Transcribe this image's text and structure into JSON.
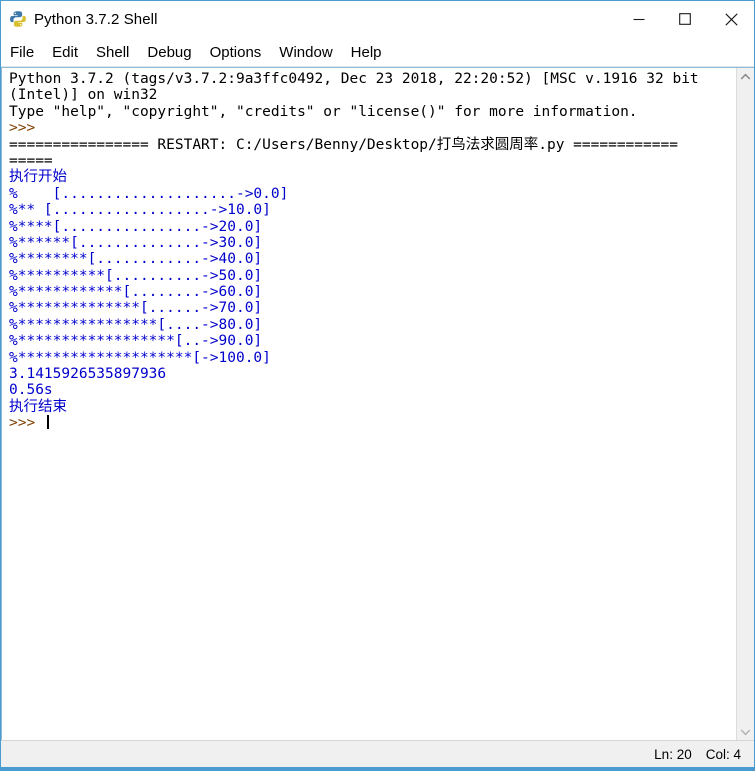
{
  "window": {
    "title": "Python 3.7.2 Shell",
    "icon": "python-logo-icon",
    "controls": {
      "minimize": "minimize-icon",
      "maximize": "maximize-icon",
      "close": "close-icon"
    }
  },
  "menubar": {
    "items": [
      {
        "label": "File"
      },
      {
        "label": "Edit"
      },
      {
        "label": "Shell"
      },
      {
        "label": "Debug"
      },
      {
        "label": "Options"
      },
      {
        "label": "Window"
      },
      {
        "label": "Help"
      }
    ]
  },
  "console": {
    "lines": [
      {
        "text": "Python 3.7.2 (tags/v3.7.2:9a3ffc0492, Dec 23 2018, 22:20:52) [MSC v.1916 32 bit",
        "color": "black"
      },
      {
        "text": "(Intel)] on win32",
        "color": "black"
      },
      {
        "text": "Type \"help\", \"copyright\", \"credits\" or \"license()\" for more information.",
        "color": "black"
      },
      {
        "text": ">>> ",
        "color": "prompt"
      },
      {
        "text": "================ RESTART: C:/Users/Benny/Desktop/打鸟法求圆周率.py ============",
        "color": "black"
      },
      {
        "text": "=====",
        "color": "black"
      },
      {
        "text": "执行开始",
        "color": "blue"
      },
      {
        "text": "%    [....................->0.0]",
        "color": "blue"
      },
      {
        "text": "%** [..................->10.0]",
        "color": "blue"
      },
      {
        "text": "%****[................->20.0]",
        "color": "blue"
      },
      {
        "text": "%******[..............->30.0]",
        "color": "blue"
      },
      {
        "text": "%********[............->40.0]",
        "color": "blue"
      },
      {
        "text": "%**********[..........->50.0]",
        "color": "blue"
      },
      {
        "text": "%************[........->60.0]",
        "color": "blue"
      },
      {
        "text": "%**************[......->70.0]",
        "color": "blue"
      },
      {
        "text": "%****************[....->80.0]",
        "color": "blue"
      },
      {
        "text": "%******************[..->90.0]",
        "color": "blue"
      },
      {
        "text": "%********************[->100.0]",
        "color": "blue"
      },
      {
        "text": "3.1415926535897936",
        "color": "blue"
      },
      {
        "text": "0.56s",
        "color": "blue"
      },
      {
        "text": "执行结束",
        "color": "blue"
      },
      {
        "text": ">>> ",
        "color": "prompt",
        "caret": true
      }
    ]
  },
  "scrollbar": {
    "up_arrow": "chevron-up-icon",
    "down_arrow": "chevron-down-icon"
  },
  "statusbar": {
    "line": "Ln: 20",
    "col": "Col: 4"
  },
  "colors": {
    "accent": "#4a9bd1",
    "output_blue": "#0000cd",
    "prompt_brown": "#7f3f00",
    "text_black": "#000000",
    "chrome_gray": "#f0f0f0"
  }
}
